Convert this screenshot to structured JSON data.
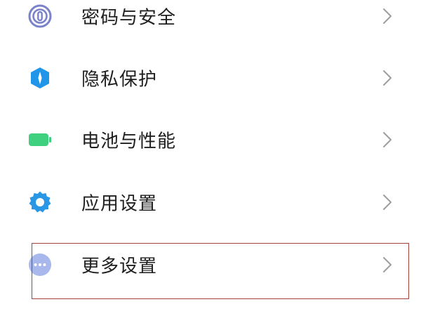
{
  "settings": {
    "items": [
      {
        "label": "密码与安全",
        "icon": "fingerprint-icon",
        "color": "#7a83c9"
      },
      {
        "label": "隐私保护",
        "icon": "privacy-shield-icon",
        "color": "#2196e8"
      },
      {
        "label": "电池与性能",
        "icon": "battery-icon",
        "color": "#3fd07f"
      },
      {
        "label": "应用设置",
        "icon": "gear-icon",
        "color": "#2a97e6"
      },
      {
        "label": "更多设置",
        "icon": "more-dots-icon",
        "color": "#a9b8ec"
      }
    ],
    "highlight": {
      "item": "更多设置",
      "color": "#a0413a"
    },
    "chevron_color": "#9e9e9e"
  }
}
